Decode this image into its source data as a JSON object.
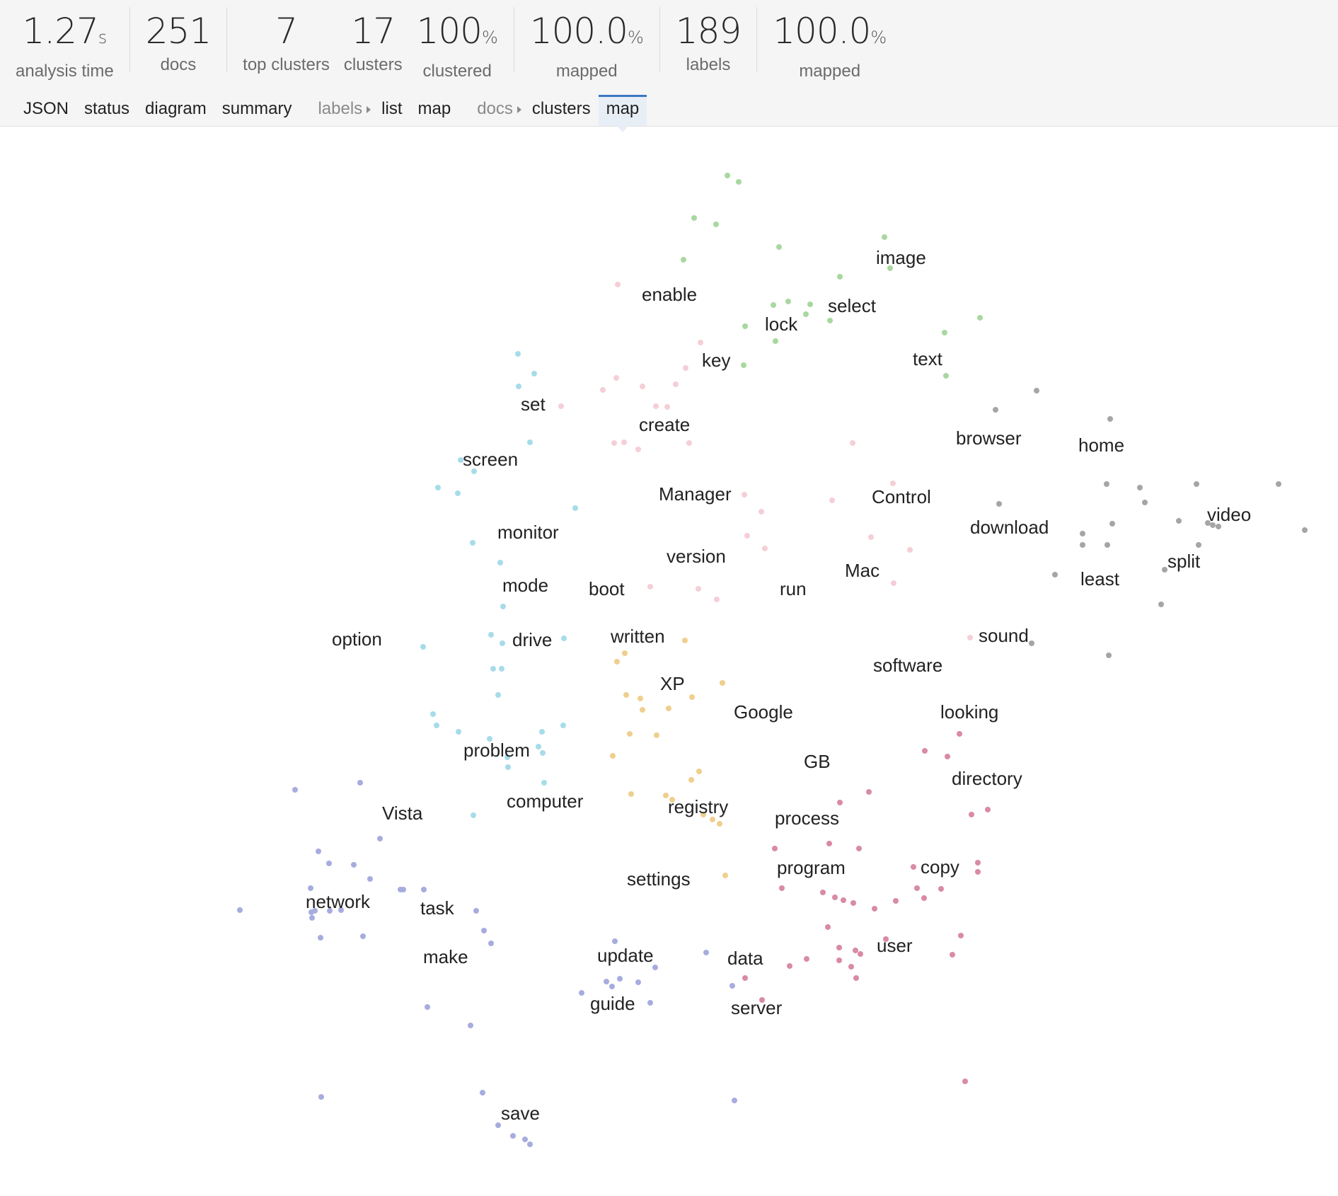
{
  "stats": [
    {
      "value": "1.27",
      "unit": "s",
      "label": "analysis time"
    },
    {
      "value": "251",
      "unit": "",
      "label": "docs"
    },
    {
      "value": "7",
      "unit": "",
      "label": "top clusters"
    },
    {
      "value": "17",
      "unit": "",
      "label": "clusters"
    },
    {
      "value": "100",
      "unit": "%",
      "label": "clustered"
    },
    {
      "value": "100.0",
      "unit": "%",
      "label": "mapped"
    },
    {
      "value": "189",
      "unit": "",
      "label": "labels"
    },
    {
      "value": "100.0",
      "unit": "%",
      "label": "mapped"
    }
  ],
  "nav": {
    "json": "JSON",
    "status": "status",
    "diagram": "diagram",
    "summary": "summary",
    "labels_group": "labels",
    "labels_list": "list",
    "labels_map": "map",
    "docs_group": "docs",
    "docs_clusters": "clusters",
    "docs_map": "map",
    "active": "docs_map"
  },
  "colors": {
    "accent": "#3a78c2",
    "cluster_green": "#a8d8a0",
    "cluster_pink": "#f5cfd6",
    "cluster_cyan": "#a6dcea",
    "cluster_gray": "#a5a5a5",
    "cluster_orange": "#f0cf8e",
    "cluster_rose": "#d98aa4",
    "cluster_blue": "#a7acdf"
  },
  "map": {
    "labels": [
      "image",
      "enable",
      "select",
      "lock",
      "key",
      "text",
      "set",
      "create",
      "browser",
      "home",
      "screen",
      "Manager",
      "Control",
      "download",
      "video",
      "monitor",
      "version",
      "split",
      "Mac",
      "least",
      "boot",
      "run",
      "mode",
      "option",
      "drive",
      "written",
      "sound",
      "software",
      "XP",
      "Google",
      "looking",
      "problem",
      "GB",
      "directory",
      "computer",
      "registry",
      "Vista",
      "process",
      "program",
      "copy",
      "settings",
      "network",
      "task",
      "user",
      "make",
      "update",
      "data",
      "guide",
      "server",
      "save"
    ]
  }
}
